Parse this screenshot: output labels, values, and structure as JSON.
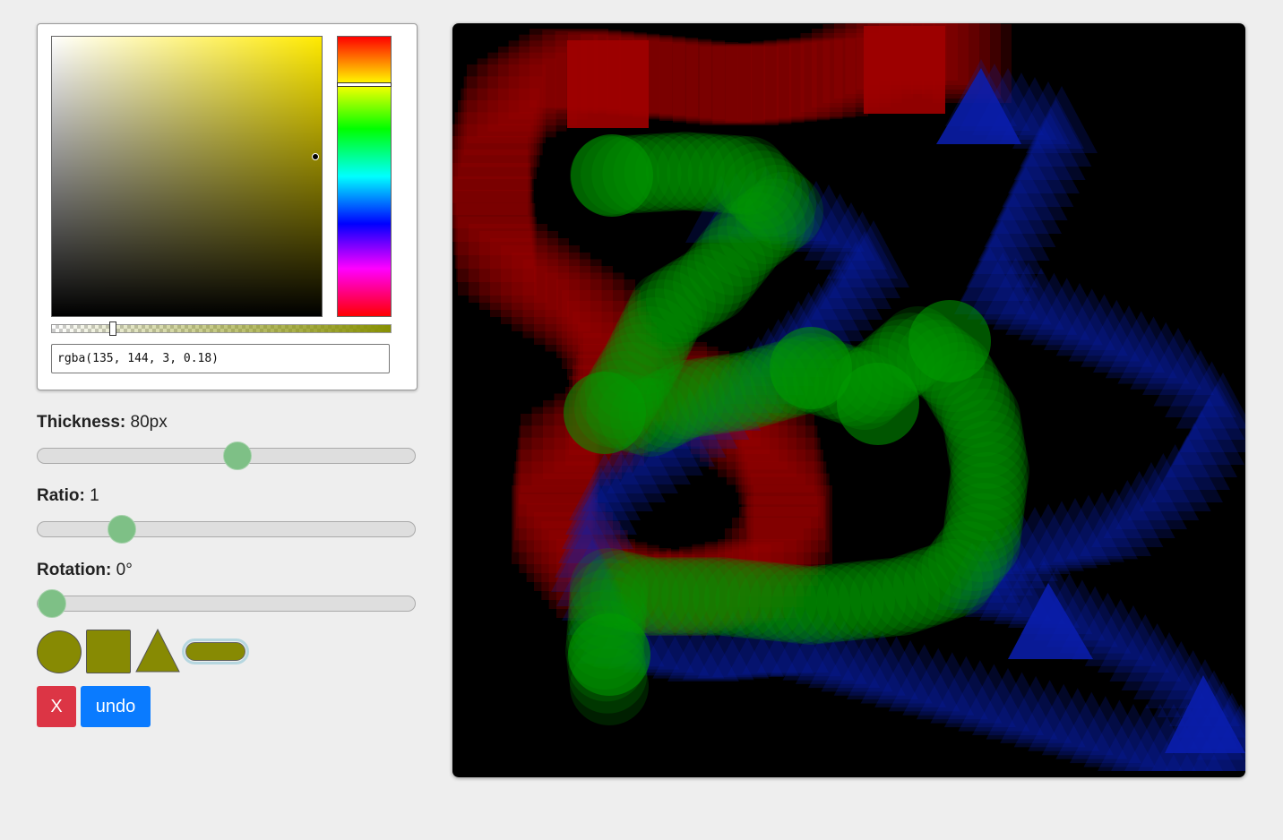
{
  "color_picker": {
    "value": "rgba(135, 144, 3, 0.18)",
    "hue_color": "#ffea00",
    "alpha_color": "#879003"
  },
  "controls": {
    "thickness": {
      "label": "Thickness:",
      "value": "80px",
      "fraction": 0.53
    },
    "ratio": {
      "label": "Ratio:",
      "value": "1",
      "fraction": 0.2
    },
    "rotation": {
      "label": "Rotation:",
      "value": "0°",
      "fraction": 0.0
    }
  },
  "shapes": {
    "fill": "#878a03",
    "items": [
      "circle",
      "square",
      "triangle",
      "pill"
    ],
    "selected": "pill"
  },
  "buttons": {
    "clear_label": "X",
    "undo_label": "undo"
  },
  "canvas": {
    "background": "#000000",
    "stroke_colors": {
      "red": "#a00000",
      "green": "#009a00",
      "blue": "#0a1fb0"
    }
  }
}
